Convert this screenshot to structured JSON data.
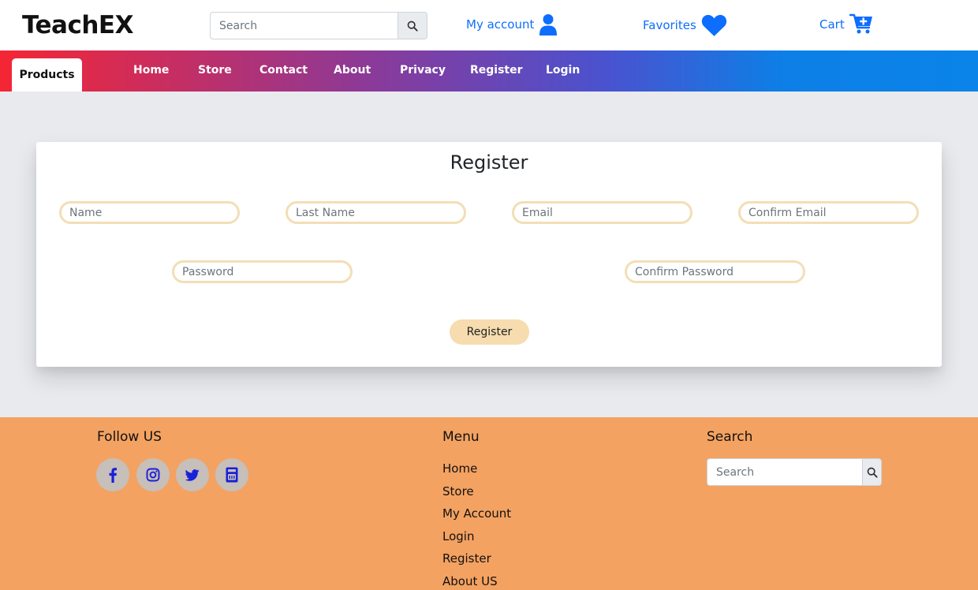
{
  "header": {
    "logo": "TeachEX",
    "search": {
      "placeholder": "Search"
    },
    "my_account": "My account",
    "favorites": "Favorites",
    "cart": "Cart",
    "accent_color": "#0d6efd"
  },
  "nav": {
    "active_tab": "Products",
    "items": [
      "Home",
      "Store",
      "Contact",
      "About",
      "Privacy",
      "Register",
      "Login"
    ],
    "gradient_colors": [
      "#f52634",
      "#8a3a99",
      "#0a84e8"
    ]
  },
  "register": {
    "title": "Register",
    "fields": {
      "name": "Name",
      "last_name": "Last Name",
      "email": "Email",
      "confirm_email": "Confirm Email",
      "password": "Password",
      "confirm_password": "Confirm Password"
    },
    "submit_label": "Register",
    "field_border_color": "#f3deb6",
    "button_color": "#f6dcae"
  },
  "footer": {
    "background_color": "#f4a261",
    "follow_heading": "Follow US",
    "social_icons": [
      "facebook-icon",
      "instagram-icon",
      "twitter-icon",
      "youtube-icon"
    ],
    "menu_heading": "Menu",
    "menu_items": [
      "Home",
      "Store",
      "My Account",
      "Login",
      "Register",
      "About US"
    ],
    "search_heading": "Search",
    "search_placeholder": "Search"
  }
}
